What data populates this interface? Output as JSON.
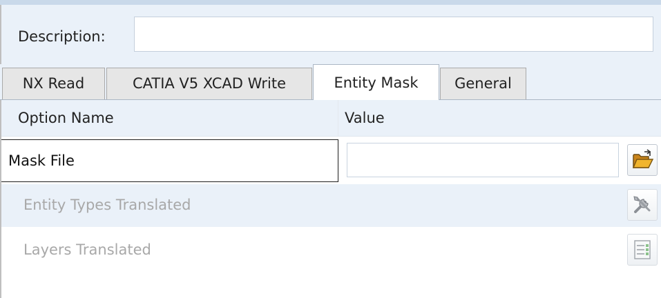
{
  "description": {
    "label": "Description:",
    "value": ""
  },
  "tabs": [
    {
      "label": "NX Read",
      "active": false
    },
    {
      "label": "CATIA V5 XCAD Write",
      "active": false
    },
    {
      "label": "Entity Mask",
      "active": true
    },
    {
      "label": "General",
      "active": false
    }
  ],
  "columns": {
    "option_name": "Option Name",
    "value": "Value"
  },
  "rows": {
    "mask_file": {
      "name": "Mask File",
      "value": "",
      "icon": "folder-open-icon",
      "enabled": true
    },
    "entity_types": {
      "name": "Entity Types Translated",
      "icon": "tools-icon",
      "enabled": false
    },
    "layers": {
      "name": "Layers Translated",
      "icon": "layers-list-icon",
      "enabled": false
    }
  },
  "colors": {
    "panel_bg": "#eaf1f9",
    "folder_accent": "#e9a319",
    "disabled_text": "#a8a8a8"
  }
}
